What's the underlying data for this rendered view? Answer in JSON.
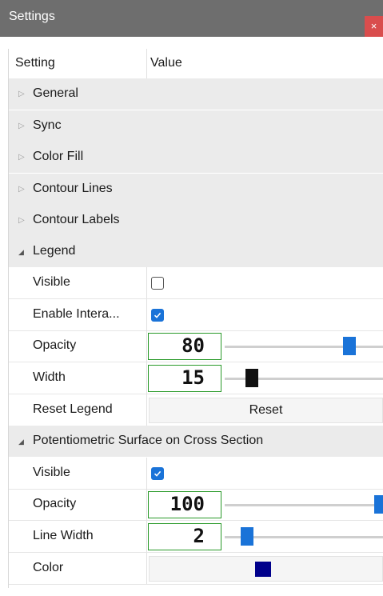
{
  "window": {
    "title": "Settings",
    "close_label": "×"
  },
  "grid": {
    "col_setting": "Setting",
    "col_value": "Value"
  },
  "categories": {
    "general": "General",
    "sync": "Sync",
    "color_fill": "Color Fill",
    "contour_lines": "Contour Lines",
    "contour_labels": "Contour Labels",
    "legend": "Legend",
    "potentiometric": "Potentiometric Surface on Cross Section"
  },
  "legend": {
    "visible": {
      "label": "Visible",
      "checked": false
    },
    "enable_interaction": {
      "label": "Enable Intera...",
      "checked": true
    },
    "opacity": {
      "label": "Opacity",
      "value": "80",
      "level": 80
    },
    "width": {
      "label": "Width",
      "value": "15",
      "level": 15
    },
    "reset": {
      "label": "Reset Legend",
      "button": "Reset"
    }
  },
  "potentiometric": {
    "visible": {
      "label": "Visible",
      "checked": true
    },
    "opacity": {
      "label": "Opacity",
      "value": "100",
      "level": 100
    },
    "line_width": {
      "label": "Line Width",
      "value": "2",
      "level": 2
    },
    "color": {
      "label": "Color",
      "swatch": "#00008b"
    }
  },
  "colors": {
    "slider_blue": "#1a73d8",
    "slider_black": "#111111",
    "lcd_border": "#2a9a2a",
    "category_bg": "#ebebeb"
  }
}
